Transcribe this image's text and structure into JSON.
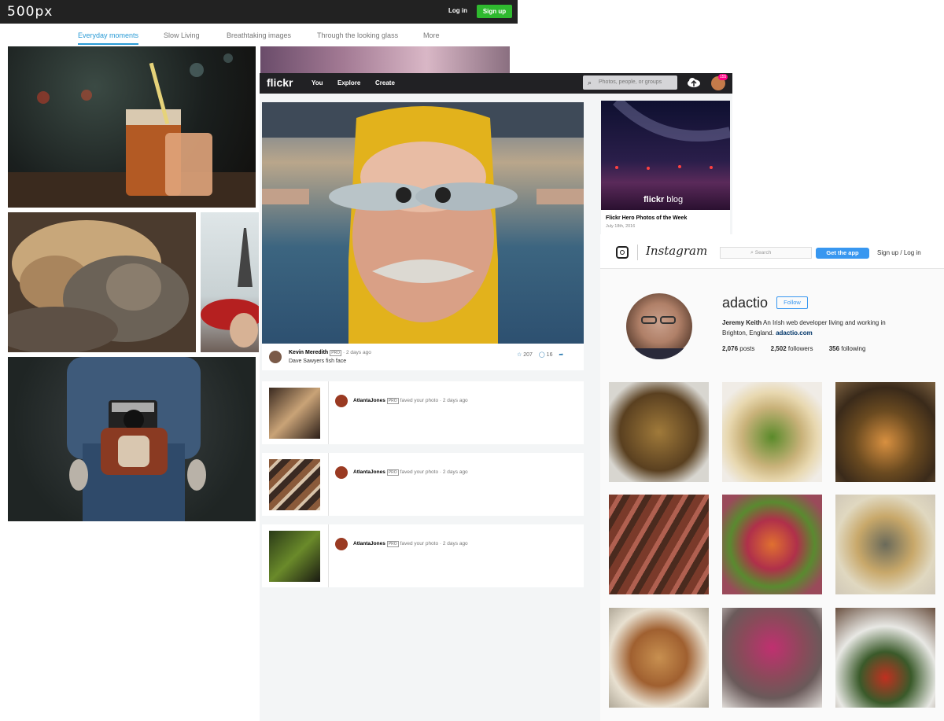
{
  "px500": {
    "logo": "500px",
    "login": "Log in",
    "signup": "Sign up",
    "tabs": [
      "Everyday moments",
      "Slow Living",
      "Breathtaking images",
      "Through the looking glass",
      "More"
    ]
  },
  "flickr": {
    "logo": "flickr",
    "nav": [
      "You",
      "Explore",
      "Create"
    ],
    "search_placeholder": "Photos, people, or groups",
    "badge": "155",
    "post": {
      "author": "Kevin Meredith",
      "pro": "PRO",
      "time": "· 2 days ago",
      "caption": "Dave Sawyers fish face",
      "faves": "207",
      "comments": "16"
    },
    "activity": [
      {
        "user": "AtlantaJones",
        "pro": "PRO",
        "text": "faved your photo · 2 days ago"
      },
      {
        "user": "AtlantaJones",
        "pro": "PRO",
        "text": "faved your photo · 2 days ago"
      },
      {
        "user": "AtlantaJones",
        "pro": "PRO",
        "text": "faved your photo · 2 days ago"
      }
    ],
    "blog": {
      "logo_bold": "flickr",
      "logo_light": " blog",
      "title": "Flickr Hero Photos of the Week",
      "date": "July 18th, 2016"
    }
  },
  "instagram": {
    "logo": "Instagram",
    "search_placeholder": "Search",
    "get_app": "Get the app",
    "signup": "Sign up",
    "sep": "/",
    "login": "Log in",
    "username": "adactio",
    "follow": "Follow",
    "name": "Jeremy Keith",
    "bio": "An Irish web developer living and working in Brighton, England.",
    "link": "adactio.com",
    "posts_count": "2,076",
    "posts_label": "posts",
    "followers_count": "2,502",
    "followers_label": "followers",
    "following_count": "356",
    "following_label": "following"
  },
  "colors": {
    "green": "#2fba2f",
    "blue": "#3897f0",
    "tab_blue": "#2a9bd6",
    "pink": "#ff0084"
  }
}
